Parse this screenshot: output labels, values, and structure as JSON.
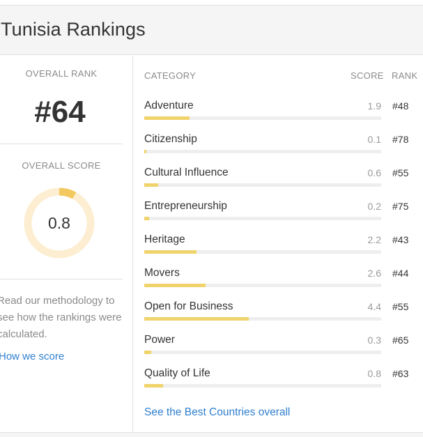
{
  "header": {
    "title": "Tunisia Rankings"
  },
  "summary": {
    "overall_rank_label": "OVERALL RANK",
    "overall_rank": "#64",
    "overall_score_label": "OVERALL SCORE",
    "overall_score": "0.8",
    "overall_score_fraction": 0.08,
    "methodology_text": "Read our methodology to see how the rankings were calculated.",
    "how_we_score_link": "How we score"
  },
  "table": {
    "headers": {
      "category": "CATEGORY",
      "score": "SCORE",
      "rank": "RANK"
    },
    "rows": [
      {
        "category": "Adventure",
        "score": "1.9",
        "rank": "#48",
        "fraction": 0.19
      },
      {
        "category": "Citizenship",
        "score": "0.1",
        "rank": "#78",
        "fraction": 0.01
      },
      {
        "category": "Cultural Influence",
        "score": "0.6",
        "rank": "#55",
        "fraction": 0.06
      },
      {
        "category": "Entrepreneurship",
        "score": "0.2",
        "rank": "#75",
        "fraction": 0.02
      },
      {
        "category": "Heritage",
        "score": "2.2",
        "rank": "#43",
        "fraction": 0.22
      },
      {
        "category": "Movers",
        "score": "2.6",
        "rank": "#44",
        "fraction": 0.26
      },
      {
        "category": "Open for Business",
        "score": "4.4",
        "rank": "#55",
        "fraction": 0.44
      },
      {
        "category": "Power",
        "score": "0.3",
        "rank": "#65",
        "fraction": 0.03
      },
      {
        "category": "Quality of Life",
        "score": "0.8",
        "rank": "#63",
        "fraction": 0.08
      }
    ],
    "see_best_link": "See the Best Countries overall"
  },
  "colors": {
    "bar_fill": "#f0d36b",
    "bar_track": "#eeeeee",
    "donut_track": "#fdeed2",
    "donut_fill": "#f3c95f",
    "link": "#2f7fd0"
  }
}
